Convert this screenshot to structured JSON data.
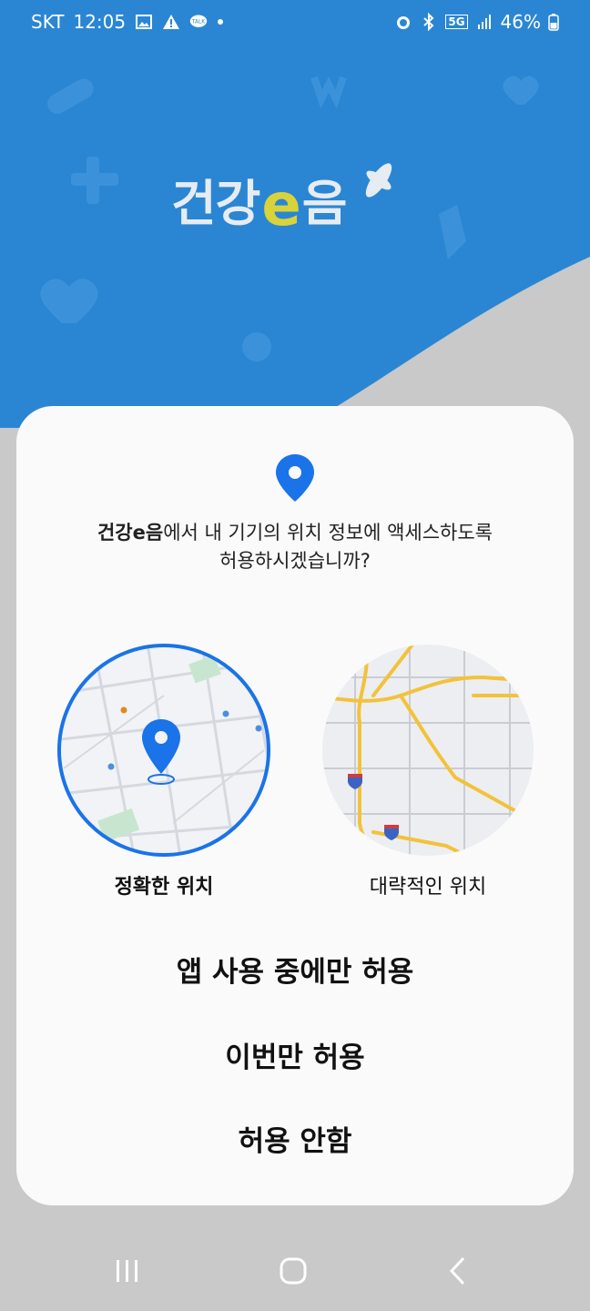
{
  "status_bar": {
    "carrier": "SKT",
    "time": "12:05",
    "battery": "46%",
    "network": "5G",
    "left_icons": [
      "image-icon",
      "warning-icon",
      "kakaotalk-icon",
      "dot-icon"
    ],
    "right_icons": [
      "alarm-icon",
      "bluetooth-icon",
      "5g-icon",
      "signal-icon",
      "battery-icon"
    ]
  },
  "app": {
    "logo_part1": "건강",
    "logo_e": "e",
    "logo_part2": "음",
    "colors": {
      "hero": "#2a86d3",
      "accent": "#d8d33a",
      "primary": "#1a73e8"
    }
  },
  "dialog": {
    "app_name": "건강e음",
    "question_rest": "에서 내 기기의 위치 정보에 액세스하도록",
    "question_line2": "허용하시겠습니까?",
    "option_precise": "정확한 위치",
    "option_approximate": "대략적인 위치",
    "selected_option": "정확한 위치",
    "btn_while_using": "앱 사용 중에만 허용",
    "btn_only_this_time": "이번만 허용",
    "btn_deny": "허용 안함"
  },
  "nav": {
    "icons": [
      "recent-apps-icon",
      "home-icon",
      "back-icon"
    ]
  }
}
